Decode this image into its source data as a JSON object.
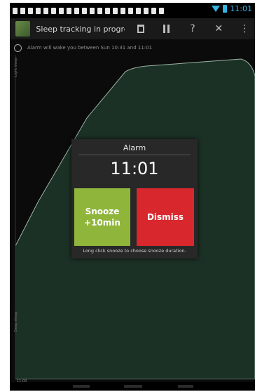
{
  "status_bar": {
    "time": "11:01"
  },
  "action_bar": {
    "title": "Sleep tracking in progre...",
    "icons": [
      "trash-icon",
      "pause-icon",
      "help-icon",
      "close-icon",
      "overflow-menu-icon"
    ],
    "help_label": "?",
    "close_label": "✕",
    "overflow_label": "⋮"
  },
  "alarm_info": {
    "text": "Alarm will wake you between Sun 10:31 and 11:01"
  },
  "graph": {
    "label_top": "Light sleep",
    "label_bottom": "Deep sleep",
    "time_label": "11:00",
    "fill_color": "#1c3125",
    "edge_color": "#9db5a6"
  },
  "dialog": {
    "title": "Alarm",
    "time": "11:01",
    "snooze_label": "Snooze\n+10min",
    "dismiss_label": "Dismiss",
    "hint": "Long click snooze to choose snooze duration.",
    "snooze_color": "#8fb53b",
    "dismiss_color": "#d8282e"
  }
}
